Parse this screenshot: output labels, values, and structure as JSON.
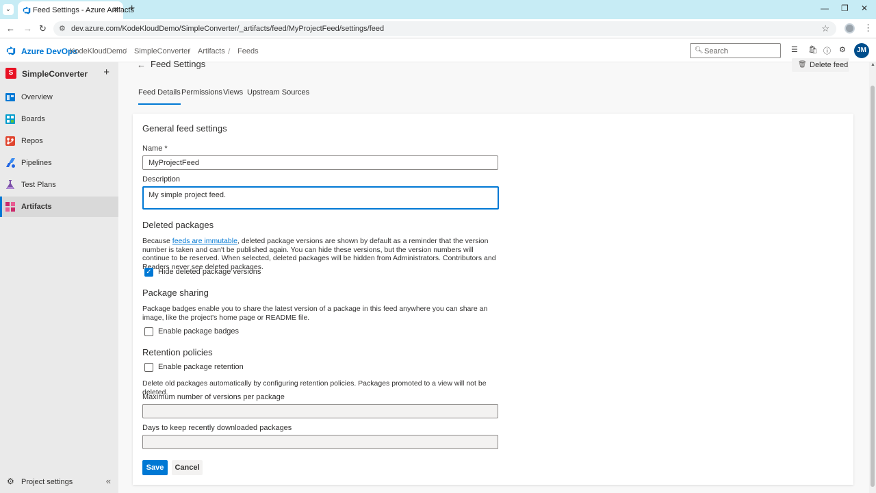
{
  "browser": {
    "tab_title": "Feed Settings - Azure Artifacts",
    "url": "dev.azure.com/KodeKloudDemo/SimpleConverter/_artifacts/feed/MyProjectFeed/settings/feed"
  },
  "header": {
    "app_name": "Azure DevOps",
    "breadcrumbs": [
      "KodeKloudDemo",
      "SimpleConverter",
      "Artifacts",
      "Feeds"
    ],
    "search_placeholder": "Search",
    "user_initials": "JM"
  },
  "sidebar": {
    "project_badge": "S",
    "project_name": "SimpleConverter",
    "items": [
      {
        "label": "Overview",
        "icon": "overview-icon",
        "color": "#0078d4"
      },
      {
        "label": "Boards",
        "icon": "boards-icon",
        "color": "#009ccc"
      },
      {
        "label": "Repos",
        "icon": "repos-icon",
        "color": "#e0452f"
      },
      {
        "label": "Pipelines",
        "icon": "pipelines-icon",
        "color": "#2266e3"
      },
      {
        "label": "Test Plans",
        "icon": "test-plans-icon",
        "color": "#7b4fa8"
      },
      {
        "label": "Artifacts",
        "icon": "artifacts-icon",
        "color": "#cc2a6b",
        "active": true
      }
    ],
    "settings_label": "Project settings"
  },
  "page": {
    "title": "Feed Settings",
    "delete_label": "Delete feed",
    "tabs": [
      "Feed Details",
      "Permissions",
      "Views",
      "Upstream Sources"
    ]
  },
  "form": {
    "general_title": "General feed settings",
    "name_label": "Name *",
    "name_value": "MyProjectFeed",
    "description_label": "Description",
    "description_value": "My simple project feed.",
    "deleted_title": "Deleted packages",
    "deleted_text_before": "Because ",
    "deleted_link": "feeds are immutable",
    "deleted_text_after": ", deleted package versions are shown by default as a reminder that the version number is taken and can't be published again. You can hide these versions, but the version numbers will continue to be reserved. When selected, deleted packages will be hidden from Administrators. Contributors and Readers never see deleted packages.",
    "hide_deleted_label": "Hide deleted package versions",
    "hide_deleted_checked": true,
    "sharing_title": "Package sharing",
    "sharing_text": "Package badges enable you to share the latest version of a package in this feed anywhere you can share an image, like the project's home page or README file.",
    "badges_label": "Enable package badges",
    "retention_title": "Retention policies",
    "retention_label": "Enable package retention",
    "retention_text": "Delete old packages automatically by configuring retention policies. Packages promoted to a view will not be deleted.",
    "max_versions_label": "Maximum number of versions per package",
    "days_label": "Days to keep recently downloaded packages",
    "save_label": "Save",
    "cancel_label": "Cancel"
  }
}
